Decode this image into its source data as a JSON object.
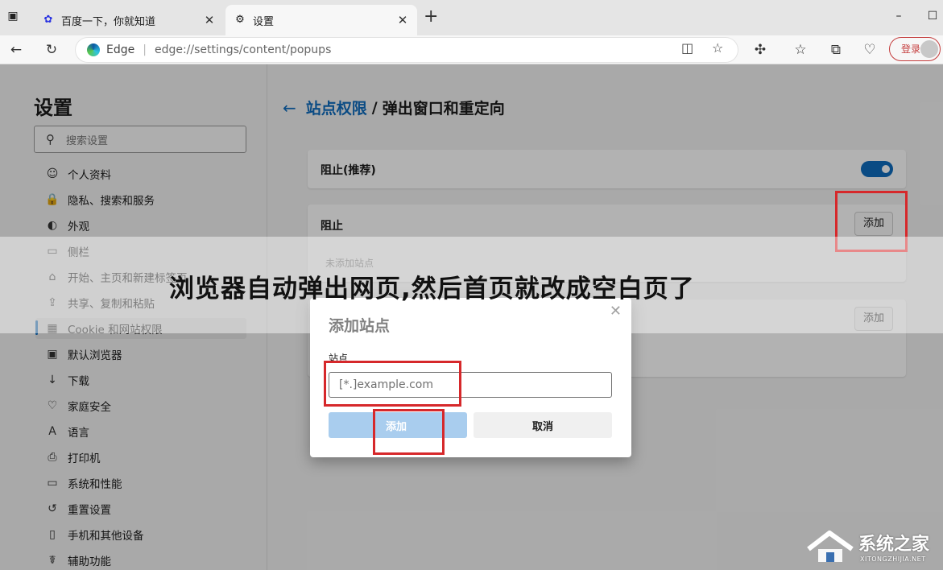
{
  "browser": {
    "tabs": [
      {
        "title": "百度一下，你就知道",
        "active": false
      },
      {
        "title": "设置",
        "active": true
      }
    ],
    "window_controls": {
      "minimize": "–",
      "maximize": "☐"
    },
    "address": {
      "site_label": "Edge",
      "separator": "|",
      "url": "edge://settings/content/popups"
    },
    "login_label": "登录"
  },
  "sidebar": {
    "title": "设置",
    "search_placeholder": "搜索设置",
    "items": [
      {
        "label": "个人资料",
        "icon": "profile-icon",
        "glyph": "☺"
      },
      {
        "label": "隐私、搜索和服务",
        "icon": "lock-icon",
        "glyph": "🔒"
      },
      {
        "label": "外观",
        "icon": "palette-icon",
        "glyph": "◐"
      },
      {
        "label": "侧栏",
        "icon": "sidebar-icon",
        "glyph": "▭"
      },
      {
        "label": "开始、主页和新建标签页",
        "icon": "home-icon",
        "glyph": "⌂"
      },
      {
        "label": "共享、复制和粘贴",
        "icon": "share-icon",
        "glyph": "⇪"
      },
      {
        "label": "Cookie 和网站权限",
        "icon": "cookie-icon",
        "glyph": "▦"
      },
      {
        "label": "默认浏览器",
        "icon": "browser-icon",
        "glyph": "▣"
      },
      {
        "label": "下载",
        "icon": "download-icon",
        "glyph": "↓"
      },
      {
        "label": "家庭安全",
        "icon": "family-icon",
        "glyph": "♡"
      },
      {
        "label": "语言",
        "icon": "language-icon",
        "glyph": "A"
      },
      {
        "label": "打印机",
        "icon": "printer-icon",
        "glyph": "⎙"
      },
      {
        "label": "系统和性能",
        "icon": "laptop-icon",
        "glyph": "▭"
      },
      {
        "label": "重置设置",
        "icon": "reset-icon",
        "glyph": "↺"
      },
      {
        "label": "手机和其他设备",
        "icon": "phone-icon",
        "glyph": "▯"
      },
      {
        "label": "辅助功能",
        "icon": "accessibility-icon",
        "glyph": "☤"
      }
    ],
    "active_index": 6
  },
  "main": {
    "breadcrumb_parent": "站点权限",
    "breadcrumb_sep": "/",
    "breadcrumb_current": "弹出窗口和重定向",
    "block_recommended_label": "阻止(推荐)",
    "block_section_label": "阻止",
    "block_empty_text": "未添加站点",
    "add_label": "添加",
    "allow_add_label": "添加"
  },
  "dialog": {
    "title": "添加站点",
    "field_label": "站点",
    "field_placeholder": "[*.]example.com",
    "add_label": "添加",
    "cancel_label": "取消"
  },
  "caption": "浏览器自动弹出网页,然后首页就改成空白页了",
  "watermark": {
    "name": "系统之家",
    "domain": "XITONGZHIJIA.NET"
  },
  "colors": {
    "accent": "#0f6cbd",
    "annotation_red": "#d6282b"
  }
}
